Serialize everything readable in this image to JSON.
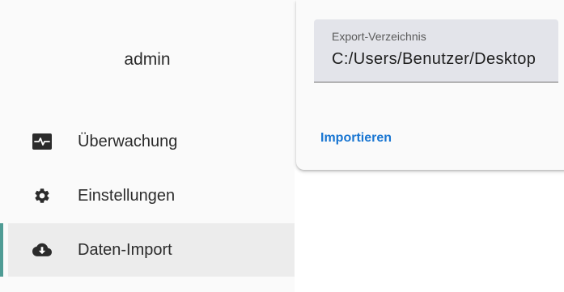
{
  "sidebar": {
    "user_name": "admin",
    "items": [
      {
        "label": "Überwachung",
        "icon": "monitor-heartbeat-icon",
        "active": false
      },
      {
        "label": "Einstellungen",
        "icon": "gear-icon",
        "active": false
      },
      {
        "label": "Daten-Import",
        "icon": "cloud-download-icon",
        "active": true
      }
    ],
    "active_indicator_color": "#4f9c95"
  },
  "export_card": {
    "field_label": "Export-Verzeichnis",
    "field_value": "C:/Users/Benutzer/Desktop",
    "import_button_label": "Importieren",
    "accent_color": "#1976d2"
  }
}
